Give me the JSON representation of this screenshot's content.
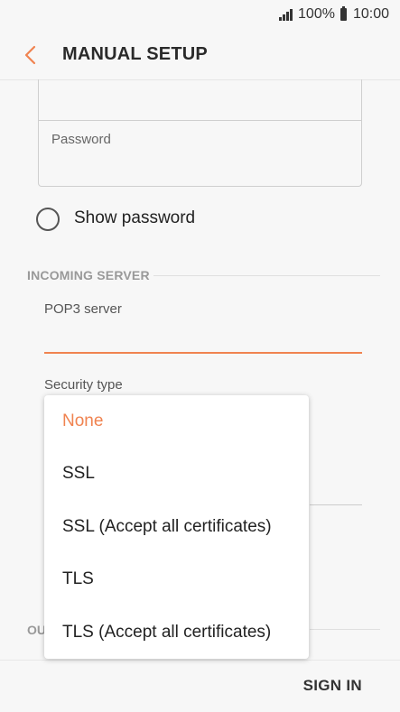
{
  "status_bar": {
    "battery": "100%",
    "time": "10:00"
  },
  "header": {
    "title": "MANUAL SETUP"
  },
  "form": {
    "password_label": "Password",
    "show_password_label": "Show password",
    "incoming_section": "INCOMING SERVER",
    "pop3_label": "POP3 server",
    "pop3_value": "",
    "security_label": "Security type",
    "outgoing_section_partial": "OU"
  },
  "dropdown": {
    "options": [
      {
        "label": "None",
        "selected": true
      },
      {
        "label": "SSL",
        "selected": false
      },
      {
        "label": "SSL (Accept all certificates)",
        "selected": false
      },
      {
        "label": "TLS",
        "selected": false
      },
      {
        "label": "TLS (Accept all certificates)",
        "selected": false
      }
    ]
  },
  "footer": {
    "sign_in": "SIGN IN"
  },
  "colors": {
    "accent": "#f08350"
  }
}
